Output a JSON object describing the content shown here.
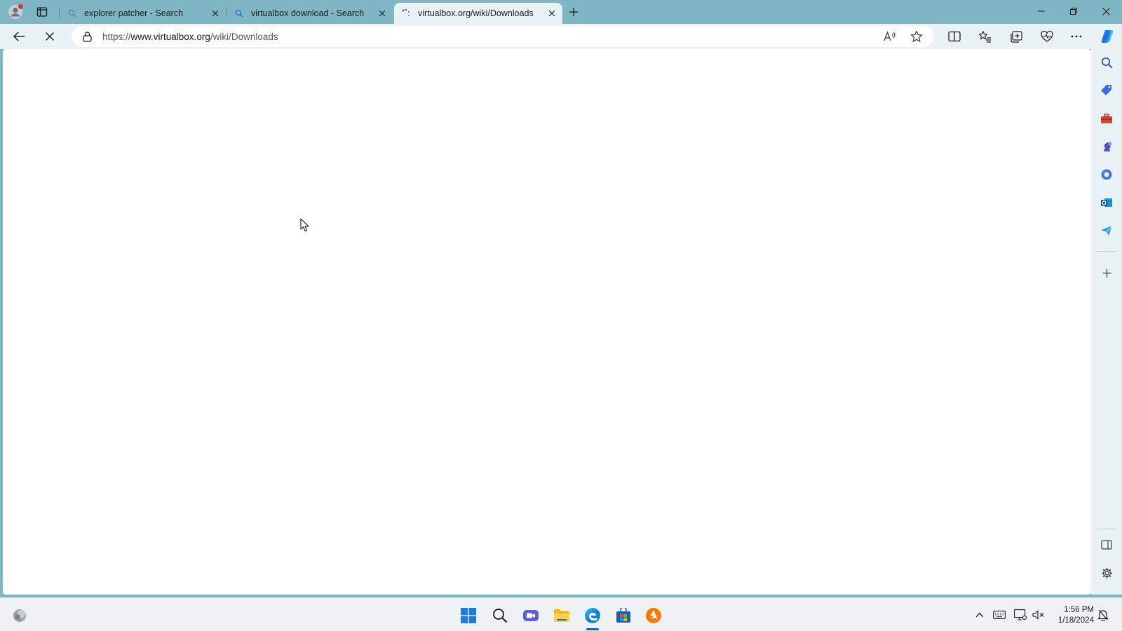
{
  "browser": {
    "tabs": [
      {
        "title": "explorer patcher - Search",
        "favicon": "search-icon",
        "active": false
      },
      {
        "title": "virtualbox download - Search",
        "favicon": "search-icon",
        "active": false
      },
      {
        "title": "virtualbox.org/wiki/Downloads",
        "favicon": "loading-icon",
        "active": true
      }
    ],
    "address": {
      "scheme": "https://",
      "host": "www.virtualbox.org",
      "path": "/wiki/Downloads"
    }
  },
  "taskbar": {
    "pinned": [
      "start-icon",
      "search-icon",
      "meet-icon",
      "file-explorer-icon",
      "edge-icon",
      "store-icon",
      "avast-icon"
    ],
    "clock": {
      "time": "1:56 PM",
      "date": "1/18/2024"
    }
  },
  "colors": {
    "chrome_frame": "#7fb6c4",
    "toolbar": "#e9f3f6",
    "content": "#ffffff",
    "taskbar": "#eef2f4"
  }
}
